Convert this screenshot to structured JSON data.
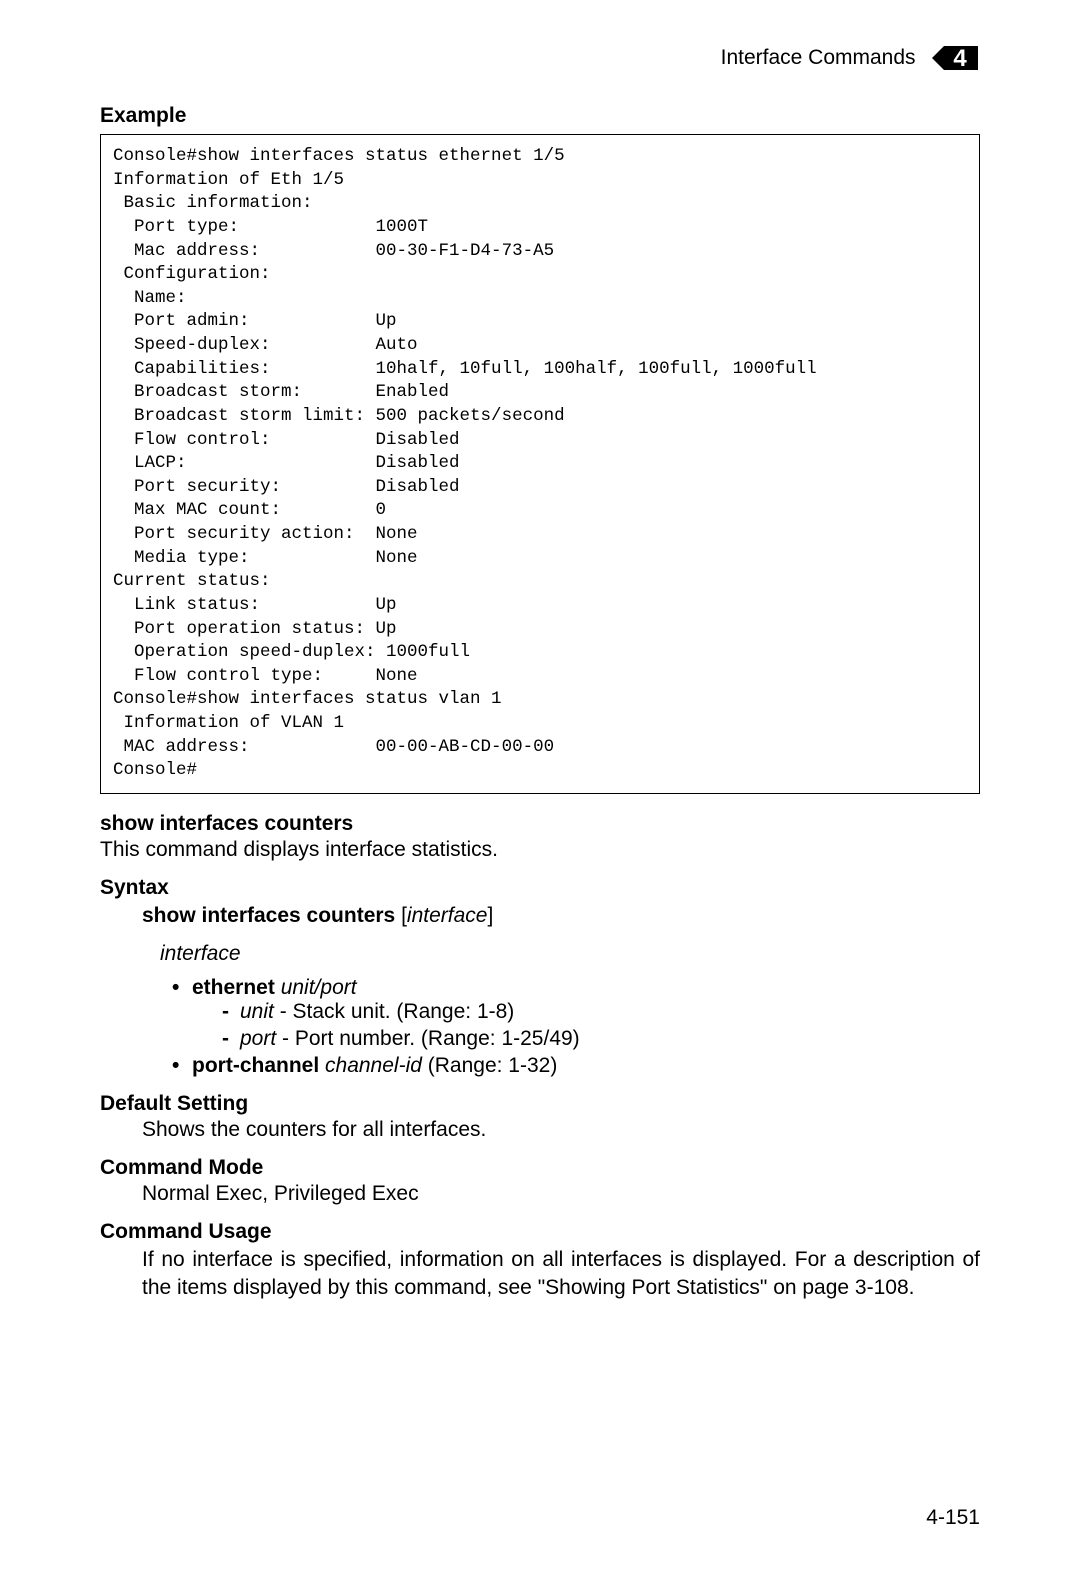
{
  "header": {
    "title": "Interface Commands",
    "chapter": "4"
  },
  "example": {
    "heading": "Example",
    "code": "Console#show interfaces status ethernet 1/5\nInformation of Eth 1/5\n Basic information:\n  Port type:             1000T\n  Mac address:           00-30-F1-D4-73-A5\n Configuration:\n  Name:\n  Port admin:            Up\n  Speed-duplex:          Auto\n  Capabilities:          10half, 10full, 100half, 100full, 1000full\n  Broadcast storm:       Enabled\n  Broadcast storm limit: 500 packets/second\n  Flow control:          Disabled\n  LACP:                  Disabled\n  Port security:         Disabled\n  Max MAC count:         0\n  Port security action:  None\n  Media type:            None\nCurrent status:\n  Link status:           Up\n  Port operation status: Up\n  Operation speed-duplex: 1000full\n  Flow control type:     None\nConsole#show interfaces status vlan 1\n Information of VLAN 1\n MAC address:            00-00-AB-CD-00-00\nConsole#"
  },
  "command": {
    "name": "show interfaces counters",
    "description": "This command displays interface statistics."
  },
  "syntax": {
    "heading": "Syntax",
    "command_bold": "show interfaces counters",
    "bracket_open": " [",
    "param_italic": "interface",
    "bracket_close": "]",
    "interface_label": "interface",
    "ethernet_label": "ethernet",
    "unit_port": "unit/port",
    "unit_label": "unit",
    "unit_desc": " - Stack unit. (Range: 1-8)",
    "port_label": "port",
    "port_desc": " - Port number. (Range: 1-25/49)",
    "port_channel_label": "port-channel",
    "channel_id": "channel-id",
    "channel_desc": " (Range: 1-32)"
  },
  "default_setting": {
    "heading": "Default Setting",
    "text": "Shows the counters for all interfaces."
  },
  "command_mode": {
    "heading": "Command Mode",
    "text": "Normal Exec, Privileged Exec"
  },
  "command_usage": {
    "heading": "Command Usage",
    "text": "If no interface is specified, information on all interfaces is displayed. For a description of the items displayed by this command, see \"Showing Port Statistics\" on page 3-108."
  },
  "page_number": "4-151"
}
